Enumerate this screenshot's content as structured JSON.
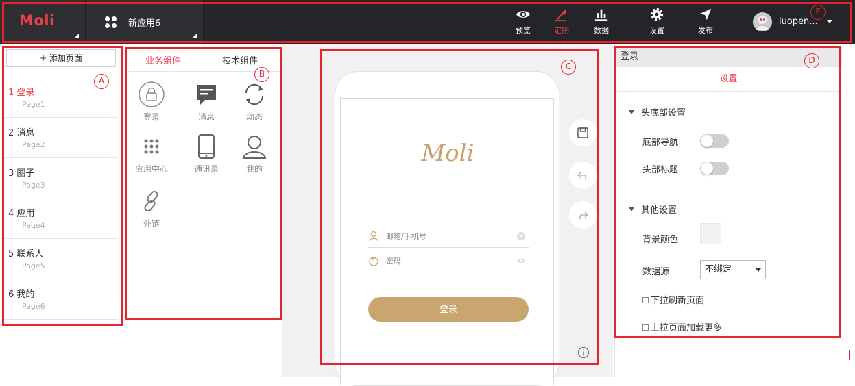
{
  "header": {
    "logo": "Moli",
    "app_name": "新应用6",
    "nav": [
      {
        "label": "预览",
        "icon": "eye-icon"
      },
      {
        "label": "定制",
        "icon": "quill-icon",
        "active": true
      },
      {
        "label": "数据",
        "icon": "bar-chart-icon"
      },
      {
        "label": "设置",
        "icon": "gear-icon"
      },
      {
        "label": "发布",
        "icon": "paper-plane-icon"
      }
    ],
    "user_name": "luopen...",
    "accent_color": "#e8404a"
  },
  "pages_panel": {
    "add_page_label": "+ 添加页面",
    "pages": [
      {
        "name": "1  登录",
        "id": "Page1",
        "active": true
      },
      {
        "name": "2  消息",
        "id": "Page2"
      },
      {
        "name": "3  圈子",
        "id": "Page3"
      },
      {
        "name": "4  应用",
        "id": "Page4"
      },
      {
        "name": "5  联系人",
        "id": "Page5"
      },
      {
        "name": "6  我的",
        "id": "Page6"
      }
    ]
  },
  "components_panel": {
    "tabs": [
      "业务组件",
      "技术组件"
    ],
    "active_tab": "业务组件",
    "items": [
      {
        "label": "登录",
        "icon": "lock-icon"
      },
      {
        "label": "消息",
        "icon": "message-icon"
      },
      {
        "label": "动态",
        "icon": "refresh-icon"
      },
      {
        "label": "应用中心",
        "icon": "grid-icon"
      },
      {
        "label": "通讯录",
        "icon": "tablet-icon"
      },
      {
        "label": "我的",
        "icon": "user-icon"
      },
      {
        "label": "外链",
        "icon": "link-icon"
      }
    ]
  },
  "preview": {
    "brand": "Moli",
    "username_placeholder": "邮箱/手机号",
    "password_placeholder": "密码",
    "login_button": "登录",
    "button_color": "#c9a56f"
  },
  "properties_panel": {
    "page_title": "登录",
    "tab": "设置",
    "header_footer_section": "头底部设置",
    "bottom_nav_label": "底部导航",
    "bottom_nav_on": false,
    "header_title_label": "头部标题",
    "header_title_on": false,
    "other_section": "其他设置",
    "bg_color_label": "背景颜色",
    "bg_color_value": "#f2f2f2",
    "datasource_label": "数据源",
    "datasource_value": "不绑定",
    "pull_refresh_label": "下拉刷新页面",
    "pull_refresh_checked": false,
    "load_more_label": "上拉页面加载更多",
    "load_more_checked": false
  },
  "annotations": [
    "A",
    "B",
    "C",
    "D",
    "E"
  ]
}
